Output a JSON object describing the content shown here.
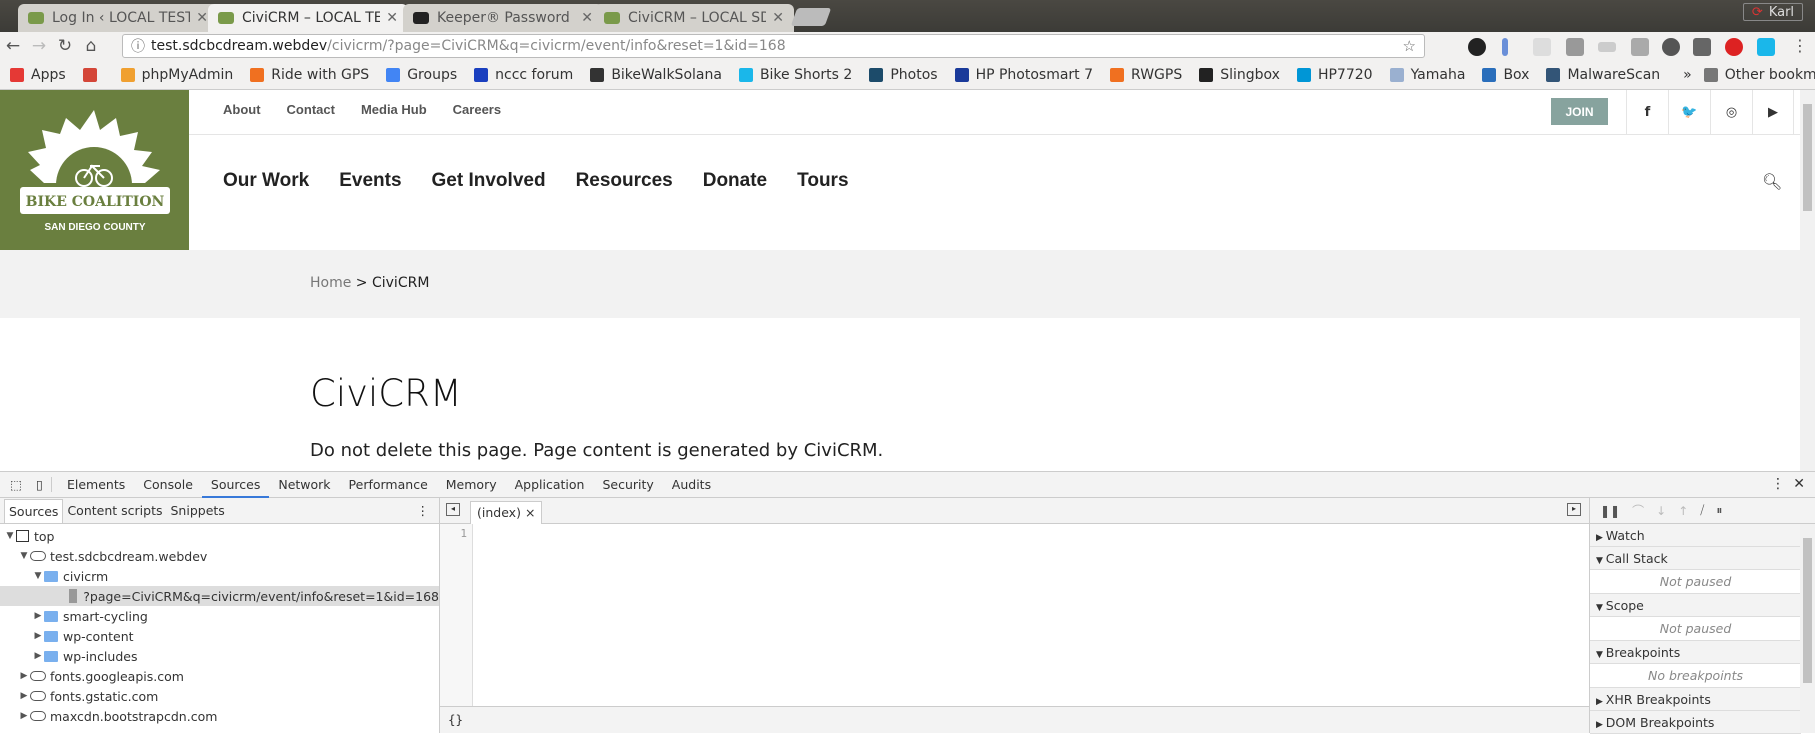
{
  "browser": {
    "tabs": [
      {
        "title": "Log In ‹ LOCAL TEST",
        "active": false
      },
      {
        "title": "CiviCRM – LOCAL TEST",
        "active": true
      },
      {
        "title": "Keeper® Password Manager",
        "active": false
      },
      {
        "title": "CiviCRM – LOCAL SDCBC",
        "active": false
      }
    ],
    "profile": "Karl",
    "url_host": "test.sdcbcdream.webdev",
    "url_path": "/civicrm/?page=CiviCRM&q=civicrm/event/info&reset=1&id=168",
    "bookmarks": [
      {
        "label": "Apps",
        "color": "#e53935"
      },
      {
        "label": "",
        "color": "#d44638"
      },
      {
        "label": "phpMyAdmin",
        "color": "#f0a030"
      },
      {
        "label": "Ride with GPS",
        "color": "#f07020"
      },
      {
        "label": "Groups",
        "color": "#4285f4"
      },
      {
        "label": "nccc forum",
        "color": "#1a3fbf"
      },
      {
        "label": "BikeWalkSolana",
        "color": "#333333"
      },
      {
        "label": "Bike Shorts 2",
        "color": "#1ab7ea"
      },
      {
        "label": "Photos",
        "color": "#1c4b6a"
      },
      {
        "label": "HP Photosmart 7",
        "color": "#1a3a9a"
      },
      {
        "label": "RWGPS",
        "color": "#f07020"
      },
      {
        "label": "Slingbox",
        "color": "#222222"
      },
      {
        "label": "HP7720",
        "color": "#0096d6"
      },
      {
        "label": "Yamaha",
        "color": "#9ab0d0"
      },
      {
        "label": "Box",
        "color": "#2a6ebb"
      },
      {
        "label": "MalwareScan",
        "color": "#335577"
      }
    ],
    "bookmarks_overflow": "»",
    "other_bookmarks": "Other bookmarks"
  },
  "site": {
    "logo_text": "BIKE COALITION",
    "logo_sub": "SAN DIEGO COUNTY",
    "brand_color": "#6a7f3f",
    "top_links": [
      "About",
      "Contact",
      "Media Hub",
      "Careers"
    ],
    "join": "JOIN",
    "social": [
      "f",
      "t",
      "ig",
      "yt"
    ],
    "main_nav": [
      "Our Work",
      "Events",
      "Get Involved",
      "Resources",
      "Donate",
      "Tours"
    ],
    "breadcrumb_home": "Home",
    "breadcrumb_sep": " > ",
    "breadcrumb_current": "CiviCRM",
    "title": "CiviCRM",
    "body": "Do not delete this page. Page content is generated by CiviCRM."
  },
  "devtools": {
    "tabs": [
      "Elements",
      "Console",
      "Sources",
      "Network",
      "Performance",
      "Memory",
      "Application",
      "Security",
      "Audits"
    ],
    "active_tab": "Sources",
    "nav_tabs": [
      "Sources",
      "Content scripts",
      "Snippets"
    ],
    "tree": [
      {
        "label": "top",
        "type": "frame",
        "depth": 0,
        "open": true
      },
      {
        "label": "test.sdcbcdream.webdev",
        "type": "cloud",
        "depth": 1,
        "open": true
      },
      {
        "label": "civicrm",
        "type": "folder",
        "depth": 2,
        "open": true
      },
      {
        "label": "?page=CiviCRM&q=civicrm/event/info&reset=1&id=168",
        "type": "file",
        "depth": 3,
        "selected": true
      },
      {
        "label": "smart-cycling",
        "type": "folder",
        "depth": 2,
        "open": false
      },
      {
        "label": "wp-content",
        "type": "folder",
        "depth": 2,
        "open": false
      },
      {
        "label": "wp-includes",
        "type": "folder",
        "depth": 2,
        "open": false
      },
      {
        "label": "fonts.googleapis.com",
        "type": "cloud",
        "depth": 1,
        "open": false
      },
      {
        "label": "fonts.gstatic.com",
        "type": "cloud",
        "depth": 1,
        "open": false
      },
      {
        "label": "maxcdn.bootstrapcdn.com",
        "type": "cloud",
        "depth": 1,
        "open": false
      }
    ],
    "editor_tab": "(index)",
    "line_number": "1",
    "format_button": "{}",
    "sections": [
      {
        "label": "Watch",
        "open": false
      },
      {
        "label": "Call Stack",
        "open": true,
        "empty": "Not paused"
      },
      {
        "label": "Scope",
        "open": true,
        "empty": "Not paused"
      },
      {
        "label": "Breakpoints",
        "open": true,
        "empty": "No breakpoints"
      },
      {
        "label": "XHR Breakpoints",
        "open": false
      },
      {
        "label": "DOM Breakpoints",
        "open": false
      }
    ]
  }
}
